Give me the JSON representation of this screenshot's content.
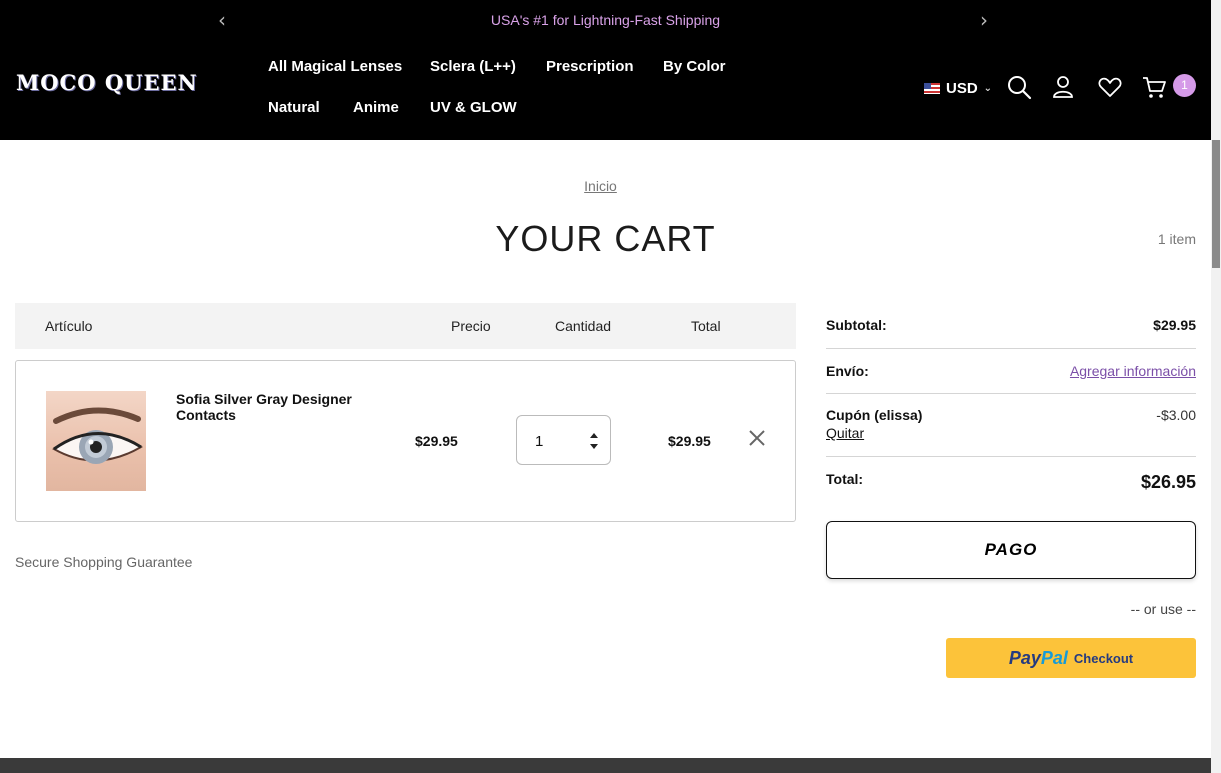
{
  "announcement": {
    "text": "USA's #1 for Lightning-Fast Shipping",
    "prev_icon": "‹",
    "next_icon": "›"
  },
  "logo": {
    "text": "MOCO QUEEN"
  },
  "nav": {
    "items": [
      {
        "label": "All Magical Lenses"
      },
      {
        "label": "Sclera (L++)"
      },
      {
        "label": "Prescription"
      },
      {
        "label": "By Color"
      },
      {
        "label": "Natural"
      },
      {
        "label": "Anime"
      },
      {
        "label": "UV & GLOW"
      }
    ]
  },
  "header": {
    "currency": "USD",
    "cart_count": "1",
    "icons": [
      "search-icon",
      "account-icon",
      "wishlist-icon",
      "cart-icon"
    ]
  },
  "breadcrumb": "Inicio",
  "page_title": "YOUR CART",
  "item_count": "1 item",
  "table": {
    "columns": [
      "Artículo",
      "Precio",
      "Cantidad",
      "Total"
    ],
    "rows": [
      {
        "name": "Sofia Silver Gray Designer Contacts",
        "price": "$29.95",
        "quantity": "1",
        "total": "$29.95"
      }
    ]
  },
  "guarantee": "Secure Shopping Guarantee",
  "summary": {
    "subtotal_label": "Subtotal:",
    "subtotal_value": "$29.95",
    "shipping_label": "Envío:",
    "shipping_link": "Agregar información",
    "coupon_label": "Cupón (elissa)",
    "coupon_remove": "Quitar",
    "coupon_value": "-$3.00",
    "total_label": "Total:",
    "total_value": "$26.95"
  },
  "checkout": {
    "pago_label": "PAGO",
    "or_use": "-- or use --",
    "paypal_pay": "Pay",
    "paypal_pal": "Pal",
    "paypal_checkout": "Checkout"
  },
  "colors": {
    "header_bg": "#000000",
    "accent_pink": "#d59ae8",
    "link_purple": "#7b4fa8",
    "paypal_yellow": "#fcc33a"
  }
}
